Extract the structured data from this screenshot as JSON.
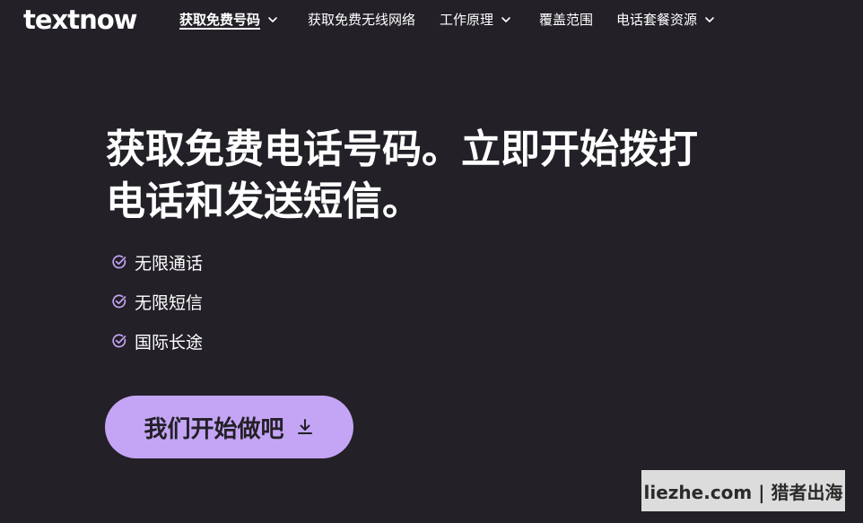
{
  "nav": {
    "logo": "textnow",
    "items": [
      {
        "label": "获取免费号码",
        "has_dropdown": true,
        "active": true
      },
      {
        "label": "获取免费无线网络",
        "has_dropdown": false,
        "active": false
      },
      {
        "label": "工作原理",
        "has_dropdown": true,
        "active": false
      },
      {
        "label": "覆盖范围",
        "has_dropdown": false,
        "active": false
      },
      {
        "label": "电话套餐资源",
        "has_dropdown": true,
        "active": false
      }
    ]
  },
  "hero": {
    "title_line1": "获取免费电话号码。立即开始拨打",
    "title_line2": "电话和发送短信。",
    "features": [
      "无限通话",
      "无限短信",
      "国际长途"
    ],
    "cta_label": "我们开始做吧"
  },
  "watermark": "liezhe.com | 猎者出海",
  "colors": {
    "background": "#232027",
    "accent": "#c4a5f5",
    "text": "#ffffff"
  },
  "icons": {
    "feature": "check-circle-icon",
    "cta": "download-arrow-icon",
    "dropdown": "chevron-down-icon"
  }
}
